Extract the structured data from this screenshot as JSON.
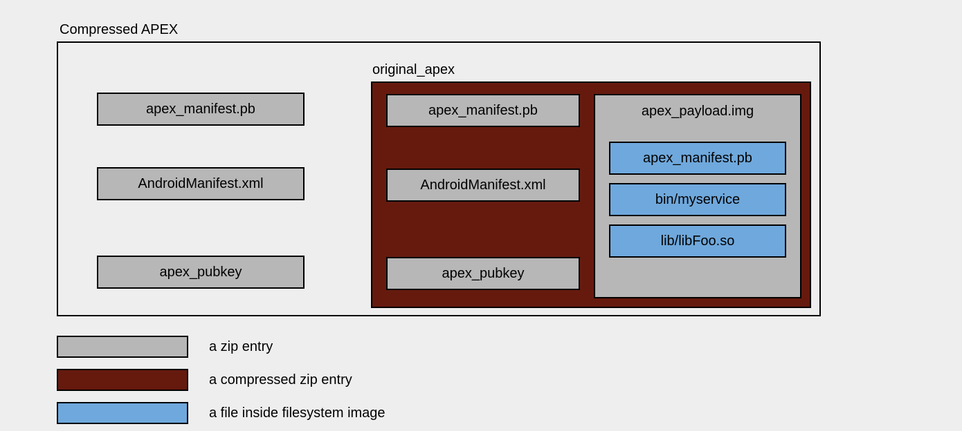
{
  "title": "Compressed APEX",
  "outer_entries": [
    "apex_manifest.pb",
    "AndroidManifest.xml",
    "apex_pubkey"
  ],
  "original_apex": {
    "label": "original_apex",
    "entries": [
      "apex_manifest.pb",
      "AndroidManifest.xml",
      "apex_pubkey"
    ],
    "payload": {
      "label": "apex_payload.img",
      "files": [
        "apex_manifest.pb",
        "bin/myservice",
        "lib/libFoo.so"
      ]
    }
  },
  "legend": [
    {
      "color": "gray",
      "label": "a zip entry"
    },
    {
      "color": "brown",
      "label": "a compressed zip entry"
    },
    {
      "color": "blue",
      "label": "a file inside filesystem image"
    }
  ]
}
